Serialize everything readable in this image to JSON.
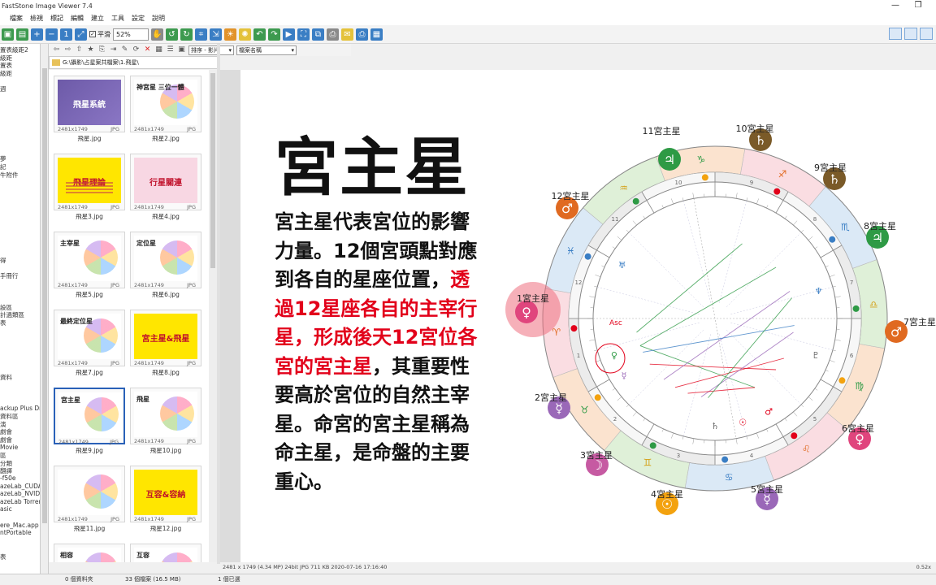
{
  "window": {
    "title": "FastStone Image Viewer 7.4",
    "minimize": "—",
    "maximize": "❐"
  },
  "menu": [
    "檔案",
    "檢視",
    "標記",
    "編輯",
    "建立",
    "工具",
    "設定",
    "說明"
  ],
  "toolbar": {
    "smooth_label": "平滑",
    "zoom": "52%",
    "colors": {
      "green": "#3d9a4f",
      "blue": "#3a7ec4",
      "orange": "#e2932a",
      "yellow": "#e4c23a"
    }
  },
  "tree": {
    "items": [
      "置表級距2",
      "級距",
      "置表",
      "級距",
      "",
      "週",
      "",
      "",
      "",
      "",
      "",
      "",
      "",
      "",
      "夢",
      "記",
      "牛附件",
      "",
      "",
      "",
      "",
      "",
      "",
      "",
      "",
      "",
      "",
      "得",
      "",
      "手冊行",
      "",
      "",
      "",
      "設區",
      "計過類區",
      "表",
      "",
      "",
      "",
      "",
      "",
      "",
      "資料",
      "",
      "",
      "",
      "ackup Plus Dr",
      "資料區",
      "演",
      "劇會",
      "劇會",
      "Movie",
      "區",
      "分類",
      "翻譯",
      "-f50e",
      "azeLab_CUDA",
      "azeLab_NVIDI",
      "azeLab Torren",
      "asic",
      "",
      "ere_Mac.app",
      "ntPortable",
      "",
      "",
      "表"
    ]
  },
  "browse": {
    "sort_by": "排序 - 影片",
    "filter": "檔案名稱",
    "path": "G:\\攝影\\占星案共檔案\\1.飛星\\"
  },
  "thumbnails": [
    {
      "name": "飛星.jpg",
      "dims": "2481x1749",
      "ext": "JPG",
      "style": "purple",
      "caption": "飛星系統"
    },
    {
      "name": "飛星2.jpg",
      "dims": "2481x1749",
      "ext": "JPG",
      "style": "white",
      "caption": "神宮星 三位一體"
    },
    {
      "name": "飛星3.jpg",
      "dims": "2481x1749",
      "ext": "JPG",
      "style": "yellow",
      "caption": "飛星理論"
    },
    {
      "name": "飛星4.jpg",
      "dims": "2481x1749",
      "ext": "JPG",
      "style": "pink",
      "caption": "行星關連"
    },
    {
      "name": "飛星5.jpg",
      "dims": "2481x1749",
      "ext": "JPG",
      "style": "white",
      "caption": "主宰星"
    },
    {
      "name": "飛星6.jpg",
      "dims": "2481x1749",
      "ext": "JPG",
      "style": "white",
      "caption": "定位星"
    },
    {
      "name": "飛星7.jpg",
      "dims": "2481x1749",
      "ext": "JPG",
      "style": "white",
      "caption": "最終定位星"
    },
    {
      "name": "飛星8.jpg",
      "dims": "2481x1749",
      "ext": "JPG",
      "style": "yellow",
      "caption": "宮主星&飛星"
    },
    {
      "name": "飛星9.jpg",
      "dims": "2481x1749",
      "ext": "JPG",
      "style": "white",
      "caption": "宮主星",
      "selected": true
    },
    {
      "name": "飛星10.jpg",
      "dims": "2481x1749",
      "ext": "JPG",
      "style": "white",
      "caption": "飛星"
    },
    {
      "name": "飛星11.jpg",
      "dims": "2481x1749",
      "ext": "JPG",
      "style": "white",
      "caption": ""
    },
    {
      "name": "飛星12.jpg",
      "dims": "2481x1749",
      "ext": "JPG",
      "style": "yellow",
      "caption": "互容&容納"
    },
    {
      "name": "",
      "dims": "",
      "ext": "",
      "style": "white",
      "caption": "相容"
    },
    {
      "name": "",
      "dims": "",
      "ext": "",
      "style": "white",
      "caption": "互容"
    }
  ],
  "preview": {
    "title": "宮主星",
    "desc_before": "宮主星代表宮位的影響力量。12個宮頭點對應到各自的星座位置，",
    "desc_red": "透過12星座各自的主宰行星，形成後天12宮位各宮的宮主星",
    "desc_after": "，其重要性要高於宮位的自然主宰星。命宮的宮主星稱為命主星，是命盤的主要重心。",
    "house_labels": [
      {
        "text": "1宮主星",
        "glyph": "♀",
        "color": "#e0457d"
      },
      {
        "text": "2宮主星",
        "glyph": "☿",
        "color": "#9a68b8"
      },
      {
        "text": "3宮主星",
        "glyph": "☽",
        "color": "#c65aa2"
      },
      {
        "text": "4宮主星",
        "glyph": "☉",
        "color": "#f3a20f"
      },
      {
        "text": "5宮主星",
        "glyph": "☿",
        "color": "#9a68b8"
      },
      {
        "text": "6宮主星",
        "glyph": "♀",
        "color": "#e0457d"
      },
      {
        "text": "7宮主星",
        "glyph": "♂",
        "color": "#e06a21"
      },
      {
        "text": "8宮主星",
        "glyph": "♃",
        "color": "#2e9a45"
      },
      {
        "text": "9宮主星",
        "glyph": "♄",
        "color": "#7a5a28"
      },
      {
        "text": "10宮主星",
        "glyph": "♄",
        "color": "#7a5a28"
      },
      {
        "text": "11宮主星",
        "glyph": "♃",
        "color": "#2e9a45"
      },
      {
        "text": "12宮主星",
        "glyph": "♂",
        "color": "#e06a21"
      }
    ],
    "zodiac": [
      "♈",
      "♉",
      "♊",
      "♋",
      "♌",
      "♍",
      "♎",
      "♏",
      "♐",
      "♑",
      "♒",
      "♓"
    ],
    "house_numbers": [
      "1",
      "2",
      "3",
      "4",
      "5",
      "6",
      "7",
      "8",
      "9",
      "10",
      "11",
      "12"
    ],
    "asc_label": "Asc"
  },
  "status": {
    "image_info": "2481 x 1749 (4.34 MP)  24bit  JPG   711 KB   2020-07-16 17:16:40",
    "zoom_ratio": "0.52x",
    "folders": "0 個資料夾",
    "files": "33 個檔案 (16.5 MB)",
    "selected": "1 個已選"
  }
}
